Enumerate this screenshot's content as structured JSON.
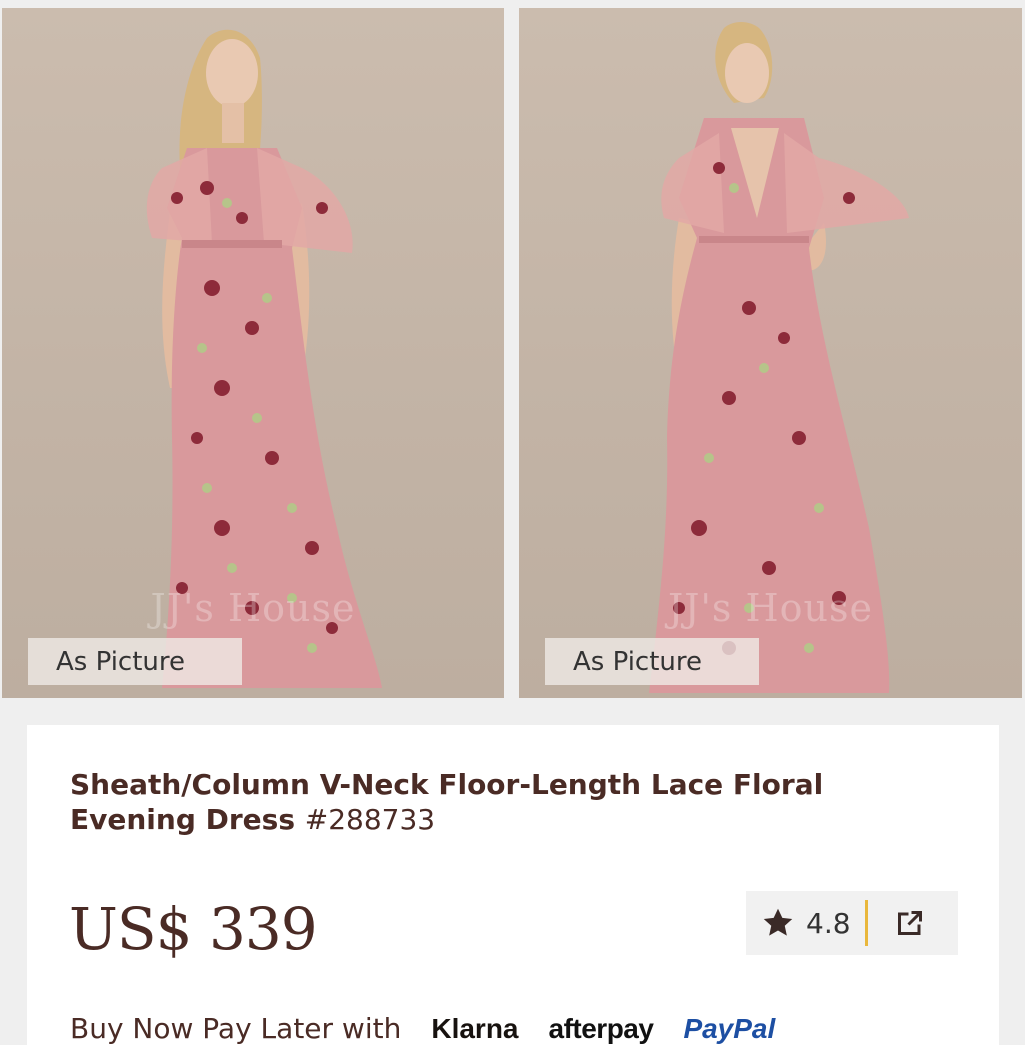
{
  "gallery": {
    "images": [
      {
        "view": "front",
        "color_label": "As Picture",
        "watermark": "JJ's House"
      },
      {
        "view": "back",
        "color_label": "As Picture",
        "watermark": "JJ's House"
      }
    ]
  },
  "product": {
    "title": "Sheath/Column V-Neck Floor-Length Lace Floral Evening Dress",
    "sku": "#288733",
    "price": "US$ 339",
    "rating": "4.8",
    "icons": {
      "rating": "star-icon",
      "share": "share-icon"
    }
  },
  "payment": {
    "text": "Buy Now Pay Later with",
    "providers": [
      "Klarna",
      "afterpay",
      "PayPal"
    ]
  },
  "colors": {
    "brand_text": "#4a2b25",
    "divider": "#e9b73c",
    "paypal_dark": "#1d4fa3",
    "paypal_light": "#2a9ad8",
    "dress_pink": "#d9999c"
  }
}
